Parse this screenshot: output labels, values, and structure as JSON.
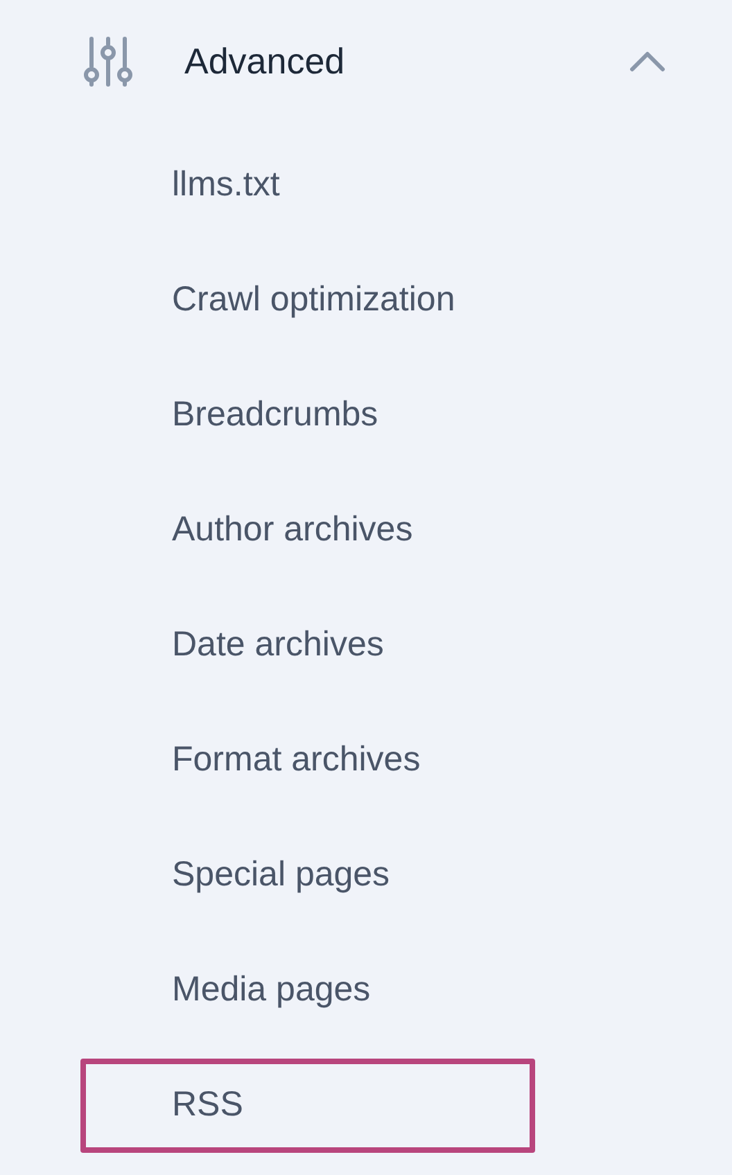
{
  "section": {
    "label": "Advanced",
    "expanded": true
  },
  "items": [
    {
      "label": "llms.txt",
      "highlighted": false
    },
    {
      "label": "Crawl optimization",
      "highlighted": false
    },
    {
      "label": "Breadcrumbs",
      "highlighted": false
    },
    {
      "label": "Author archives",
      "highlighted": false
    },
    {
      "label": "Date archives",
      "highlighted": false
    },
    {
      "label": "Format archives",
      "highlighted": false
    },
    {
      "label": "Special pages",
      "highlighted": false
    },
    {
      "label": "Media pages",
      "highlighted": false
    },
    {
      "label": "RSS",
      "highlighted": true
    }
  ]
}
